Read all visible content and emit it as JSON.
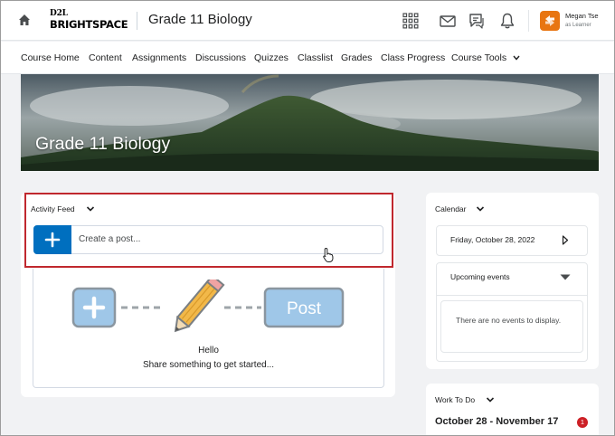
{
  "header": {
    "logo_top": "D2L",
    "logo_bottom": "BRIGHTSPACE",
    "course_title": "Grade 11 Biology",
    "user_name": "Megan Tse",
    "user_role": "as Learner"
  },
  "nav": {
    "items": [
      "Course Home",
      "Content",
      "Assignments",
      "Discussions",
      "Quizzes",
      "Classlist",
      "Grades",
      "Class Progress",
      "Course Tools"
    ]
  },
  "banner": {
    "title": "Grade 11 Biology"
  },
  "activity_feed": {
    "title": "Activity Feed",
    "placeholder": "Create a post...",
    "illustration_button": "Post",
    "empty_title": "Hello",
    "empty_subtitle": "Share something to get started..."
  },
  "calendar": {
    "title": "Calendar",
    "date": "Friday, October 28, 2022",
    "upcoming_title": "Upcoming events",
    "no_events": "There are no events to display."
  },
  "todo": {
    "title": "Work To Do",
    "range": "October 28 - November 17",
    "badge": "1"
  },
  "colors": {
    "primary": "#006fbf",
    "avatar": "#e87511",
    "highlight": "#c0282e",
    "badge": "#cd2026"
  },
  "icons": [
    "home-icon",
    "waffle-icon",
    "mail-icon",
    "chat-icon",
    "bell-icon",
    "chevron-down-icon",
    "plus-icon",
    "chevron-right-icon",
    "caret-down-icon",
    "hand-cursor-icon"
  ]
}
